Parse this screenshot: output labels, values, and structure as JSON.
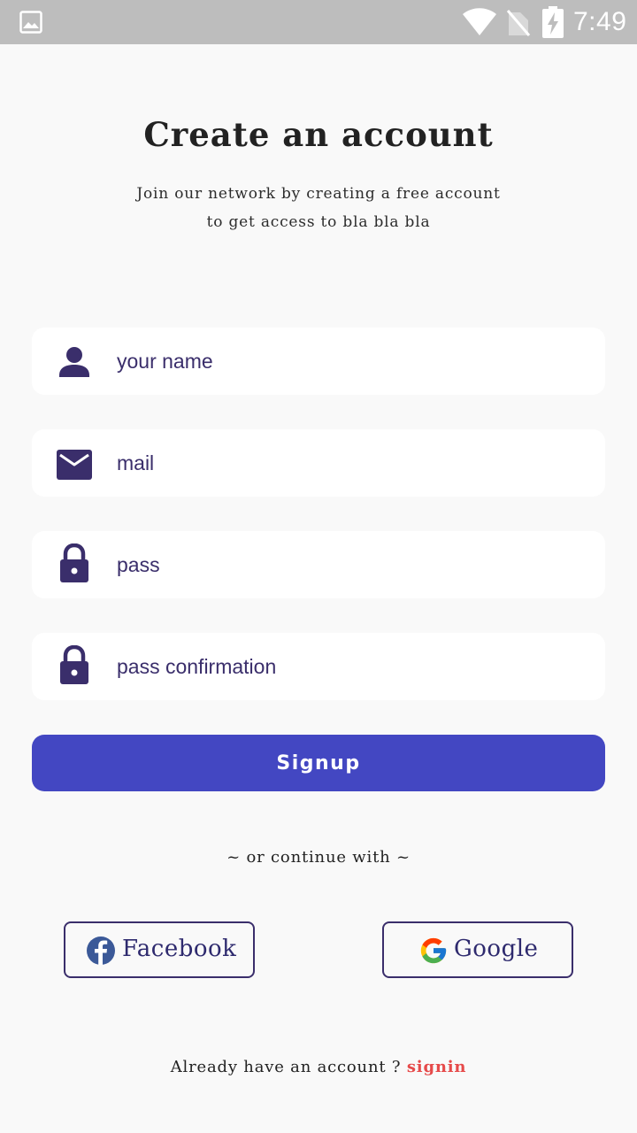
{
  "status_bar": {
    "time": "7:49",
    "icons": [
      "gallery-icon",
      "wifi-icon",
      "no-sim-icon",
      "battery-charging-icon"
    ]
  },
  "header": {
    "title": "Create an account",
    "subtitle_line1": "Join our network by creating a free account",
    "subtitle_line2": "to get access to bla bla bla"
  },
  "form": {
    "name": {
      "placeholder": "your name",
      "value": "",
      "icon": "person-icon"
    },
    "mail": {
      "placeholder": "mail",
      "value": "",
      "icon": "mail-icon"
    },
    "pass": {
      "placeholder": "pass",
      "value": "",
      "icon": "lock-icon"
    },
    "pass_confirmation": {
      "placeholder": "pass confirmation",
      "value": "",
      "icon": "lock-icon"
    },
    "signup_label": "Signup"
  },
  "social": {
    "divider_text": "~ or continue with ~",
    "facebook_label": "Facebook",
    "google_label": "Google"
  },
  "footer": {
    "prompt": "Already have an account ?",
    "signin_label": "signin"
  },
  "colors": {
    "primary": "#4347c2",
    "icon": "#3a2e6b",
    "link": "#e64a4a",
    "background": "#f9f9f9",
    "status_bar": "#bdbdbd"
  }
}
